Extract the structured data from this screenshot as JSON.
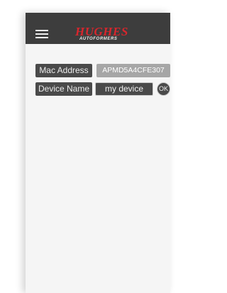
{
  "header": {
    "logo": {
      "main": "HUGHES",
      "sub": "AUTOFORMERS"
    },
    "menu_icon": "hamburger-menu-icon"
  },
  "device": {
    "mac_label": "Mac Address",
    "mac_value": "APMD5A4CFE307",
    "name_label": "Device Name",
    "name_value": "my device",
    "ok_label": "OK"
  },
  "colors": {
    "header_bg": "#3d3d3d",
    "logo_red": "#d8262d",
    "chip_dark": "#4a4a4a",
    "chip_gray": "#a6a6a6",
    "screen_bg": "#f5f5f5"
  }
}
